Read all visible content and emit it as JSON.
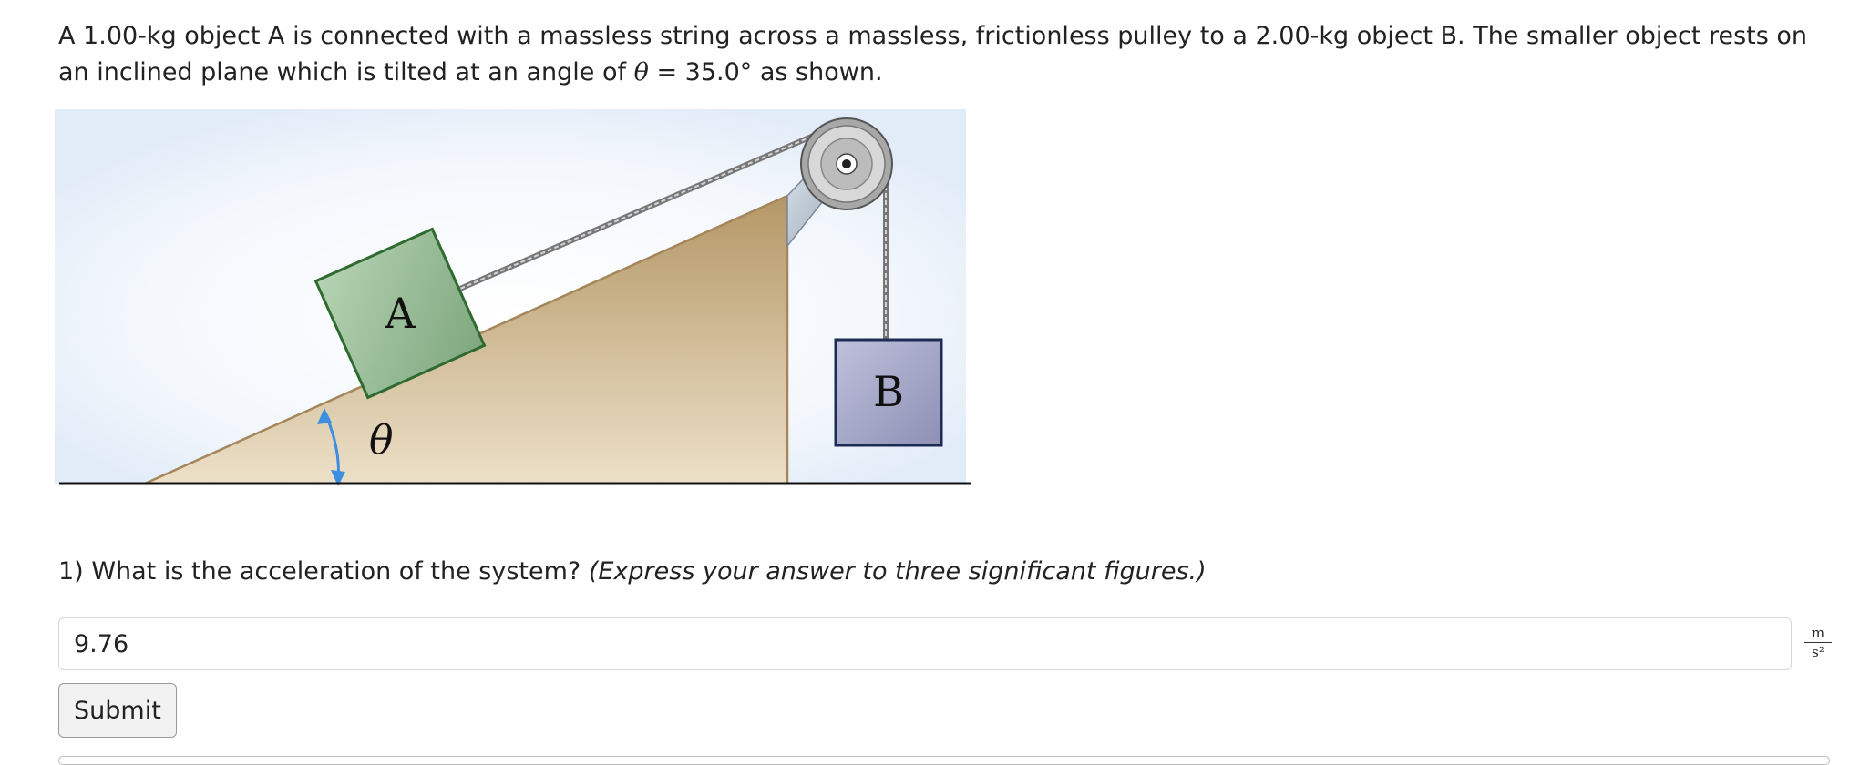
{
  "problem": {
    "text_before": "A 1.00-kg object A is connected with a massless string across a massless, frictionless pulley to a 2.00-kg object B. The smaller object rests on an inclined plane which is tilted at an angle of ",
    "theta": "θ",
    "equals": " = ",
    "angle_value": "35.0°",
    "text_after": " as shown."
  },
  "figure": {
    "block_a_label": "A",
    "block_b_label": "B",
    "angle_label": "θ"
  },
  "question": {
    "number": "1)",
    "text": "What is the acceleration of the system?",
    "hint": "(Express your answer to three significant figures.)"
  },
  "answer": {
    "value": "9.76",
    "unit_numerator": "m",
    "unit_denominator": "s²"
  },
  "submit_label": "Submit"
}
